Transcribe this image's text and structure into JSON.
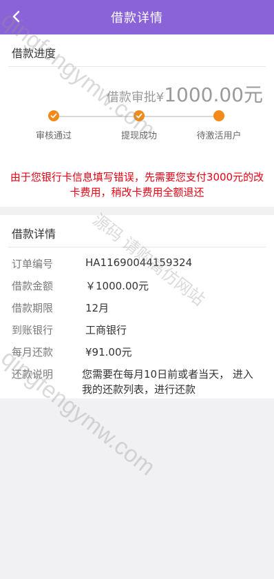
{
  "header": {
    "title": "借款详情"
  },
  "progress": {
    "title": "借款进度",
    "amount_prefix": "借款审批¥",
    "amount_value": "1000.00元",
    "steps": [
      {
        "label": "审核通过",
        "state": "done"
      },
      {
        "label": "提现成功",
        "state": "done"
      },
      {
        "label": "待激活用户",
        "state": "current"
      }
    ],
    "notice": "由于您银行卡信息填写错误，先需要您支付3000元的改卡费用，稍改卡费用全额退还"
  },
  "details": {
    "title": "借款详情",
    "rows": [
      {
        "label": "订单编号",
        "value": "HA11690044159324"
      },
      {
        "label": "借款金额",
        "value": "￥1000.00元"
      },
      {
        "label": "借款期限",
        "value": "12月"
      },
      {
        "label": "到账银行",
        "value": "工商银行"
      },
      {
        "label": "每月还款",
        "value": "¥91.00元"
      },
      {
        "label": "还款说明",
        "value": "您需要在每月10日前或者当天， 进入我的还款列表，进行还款"
      }
    ]
  },
  "colors": {
    "header_bg": "#8a63d8",
    "step_active": "#f28a1a",
    "notice": "#e60012"
  },
  "icons": {
    "back": "chevron-left-icon",
    "check": "check-icon"
  },
  "watermarks": [
    "qingfengymw.com",
    "源码 请购高仿网站",
    "qingfengymw.com"
  ]
}
